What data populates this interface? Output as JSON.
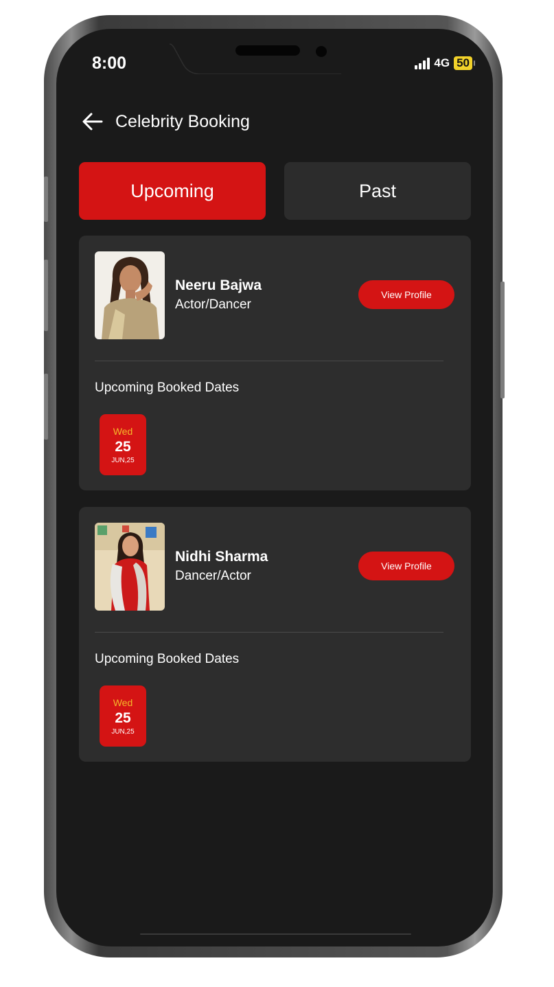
{
  "status_bar": {
    "time": "8:00",
    "network": "4G",
    "battery": "50"
  },
  "header": {
    "title": "Celebrity Booking"
  },
  "tabs": [
    {
      "label": "Upcoming",
      "active": true
    },
    {
      "label": "Past",
      "active": false
    }
  ],
  "bookings": [
    {
      "name": "Neeru Bajwa",
      "role": "Actor/Dancer",
      "view_label": "View Profile",
      "dates_label": "Upcoming Booked Dates",
      "date": {
        "day": "Wed",
        "num": "25",
        "month": "JUN,25"
      }
    },
    {
      "name": "Nidhi Sharma",
      "role": "Dancer/Actor",
      "view_label": "View Profile",
      "dates_label": "Upcoming Booked Dates",
      "date": {
        "day": "Wed",
        "num": "25",
        "month": "JUN,25"
      }
    }
  ],
  "colors": {
    "accent": "#d41414",
    "card": "#2d2d2d",
    "background": "#1a1a1a",
    "day_text": "#f5b82a"
  },
  "icons": {
    "back": "arrow-left-icon"
  }
}
